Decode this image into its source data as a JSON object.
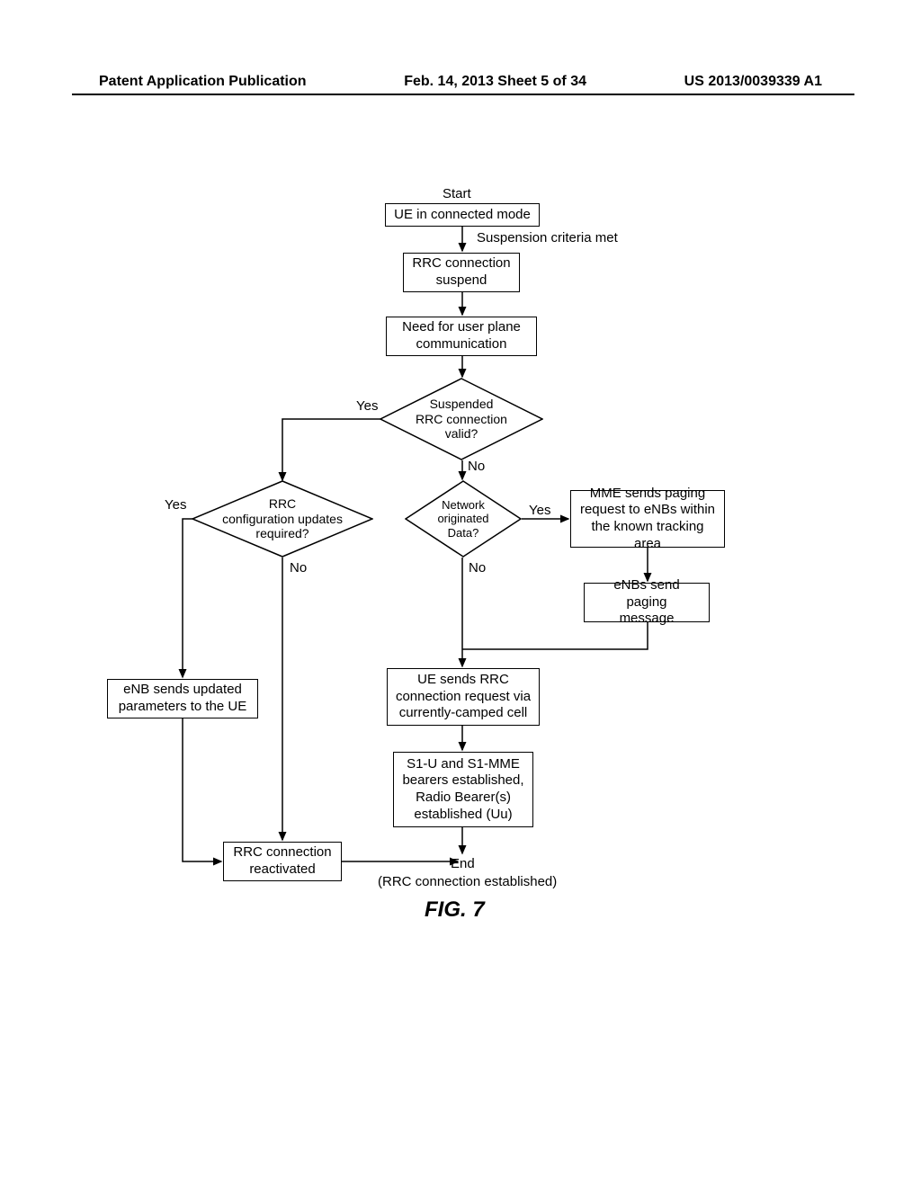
{
  "header": {
    "left": "Patent Application Publication",
    "center": "Feb. 14, 2013  Sheet 5 of 34",
    "right": "US 2013/0039339 A1"
  },
  "start_label": "Start",
  "box_connected": "UE in connected mode",
  "edge_suspension": "Suspension criteria met",
  "box_suspend": "RRC connection\nsuspend",
  "box_need": "Need for user plane\ncommunication",
  "diamond_valid": "Suspended\nRRC connection\nvalid?",
  "diamond_updates": "RRC\nconfiguration updates\nrequired?",
  "diamond_network": "Network\noriginated\nData?",
  "box_mme": "MME sends paging\nrequest to eNBs within\nthe known tracking area",
  "box_enbs_paging": "eNBs send paging\nmessage",
  "box_enb_updated": "eNB sends updated\nparameters to the UE",
  "box_ue_sends": "UE sends RRC\nconnection request via\ncurrently-camped cell",
  "box_s1": "S1-U and S1-MME\nbearers established,\nRadio Bearer(s)\nestablished (Uu)",
  "box_reactivated": "RRC connection\nreactivated",
  "yes": "Yes",
  "no": "No",
  "end_label": "End",
  "end_sub": "(RRC connection established)",
  "figure": "FIG. 7"
}
